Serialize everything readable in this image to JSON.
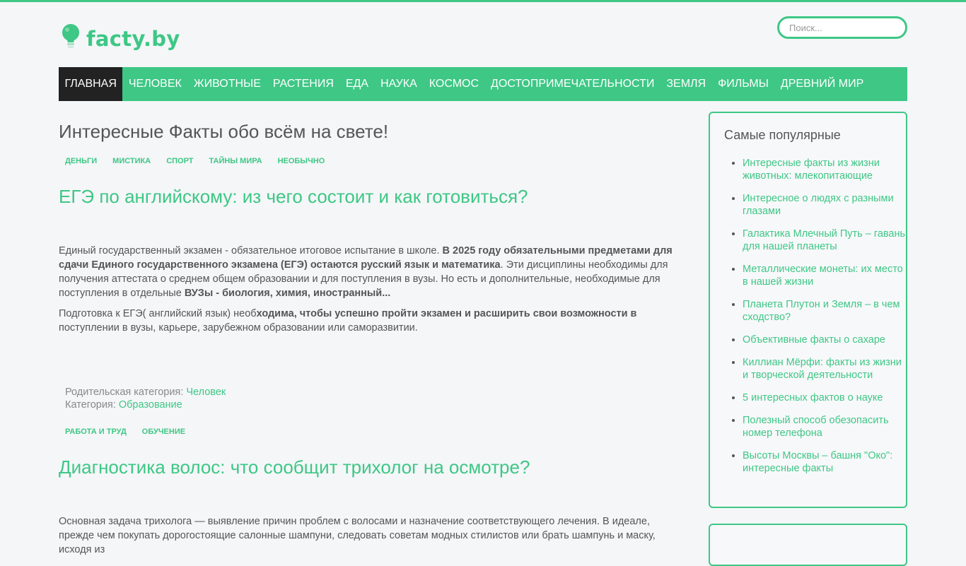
{
  "header": {
    "logo_text": "facty.by",
    "logo_icon": "lightbulb-icon",
    "search_placeholder": "Поиск..."
  },
  "colors": {
    "accent": "#3ec785",
    "active_nav": "#222222",
    "text": "#555555"
  },
  "nav": [
    {
      "label": "ГЛАВНАЯ",
      "active": true
    },
    {
      "label": "ЧЕЛОВЕК"
    },
    {
      "label": "ЖИВОТНЫЕ"
    },
    {
      "label": "РАСТЕНИЯ"
    },
    {
      "label": "ЕДА"
    },
    {
      "label": "НАУКА"
    },
    {
      "label": "КОСМОС"
    },
    {
      "label": "ДОСТОПРИМЕЧАТЕЛЬНОСТИ"
    },
    {
      "label": "ЗЕМЛЯ"
    },
    {
      "label": "ФИЛЬМЫ"
    },
    {
      "label": "ДРЕВНИЙ МИР"
    }
  ],
  "main": {
    "page_title": "Интересные Факты обо всём на свете!",
    "top_tags": [
      "ДЕНЬГИ",
      "МИСТИКА",
      "СПОРТ",
      "ТАЙНЫ МИРА",
      "НЕОБЫЧНО"
    ],
    "article1": {
      "title": "ЕГЭ по английскому: из чего состоит и как готовиться?",
      "p1_a": "Единый государственный экзамен - обязательное итоговое испытание в школе. ",
      "p1_b": "В 2025 году обязательными предметами для сдачи Единого государственного экзамена (ЕГЭ) остаются русский язык и математика",
      "p1_c": ". Эти дисциплины необходимы для получения аттестата о среднем общем образовании и для поступления в вузы. Но есть и дополнительные, необходимые для поступления в отдельные ",
      "p1_d": "ВУЗы - биология, химия, иностранный...",
      "p2_a": "Подготовка к ЕГЭ( английский язык) необ",
      "p2_b": "ходима, чтобы успешно пройти экзамен и расширить свои возможности в",
      "p2_c": " поступлении в вузы, карьере, зарубежном образовании или саморазвитии.",
      "parent_label": "Родительская категория: ",
      "parent_value": "Человек",
      "category_label": "Категория: ",
      "category_value": "Образование",
      "tags": [
        "РАБОТА И ТРУД",
        "ОБУЧЕНИЕ"
      ]
    },
    "article2": {
      "title": "Диагностика волос: что сообщит трихолог на осмотре?",
      "p1": "Основная задача трихолога — выявление причин проблем с волосами и назначение соответствующего лечения. В идеале, прежде чем покупать дорогостоящие салонные шампуни, следовать советам модных стилистов или брать шампунь и маску, исходя из"
    }
  },
  "sidebar": {
    "title": "Самые популярные",
    "items": [
      "Интересные факты из жизни животных: млекопитающие",
      "Интересное о людях с разными глазами",
      "Галактика Млечный Путь – гавань для нашей планеты",
      "Металлические монеты: их место в нашей жизни",
      "Планета Плутон и Земля – в чем сходство?",
      "Объективные факты о сахаре",
      "Киллиан Мёрфи: факты из жизни и творческой деятельности",
      "5 интересных фактов о науке",
      "Полезный способ обезопасить номер телефона",
      "Высоты Москвы – башня \"Око\": интересные факты"
    ]
  }
}
